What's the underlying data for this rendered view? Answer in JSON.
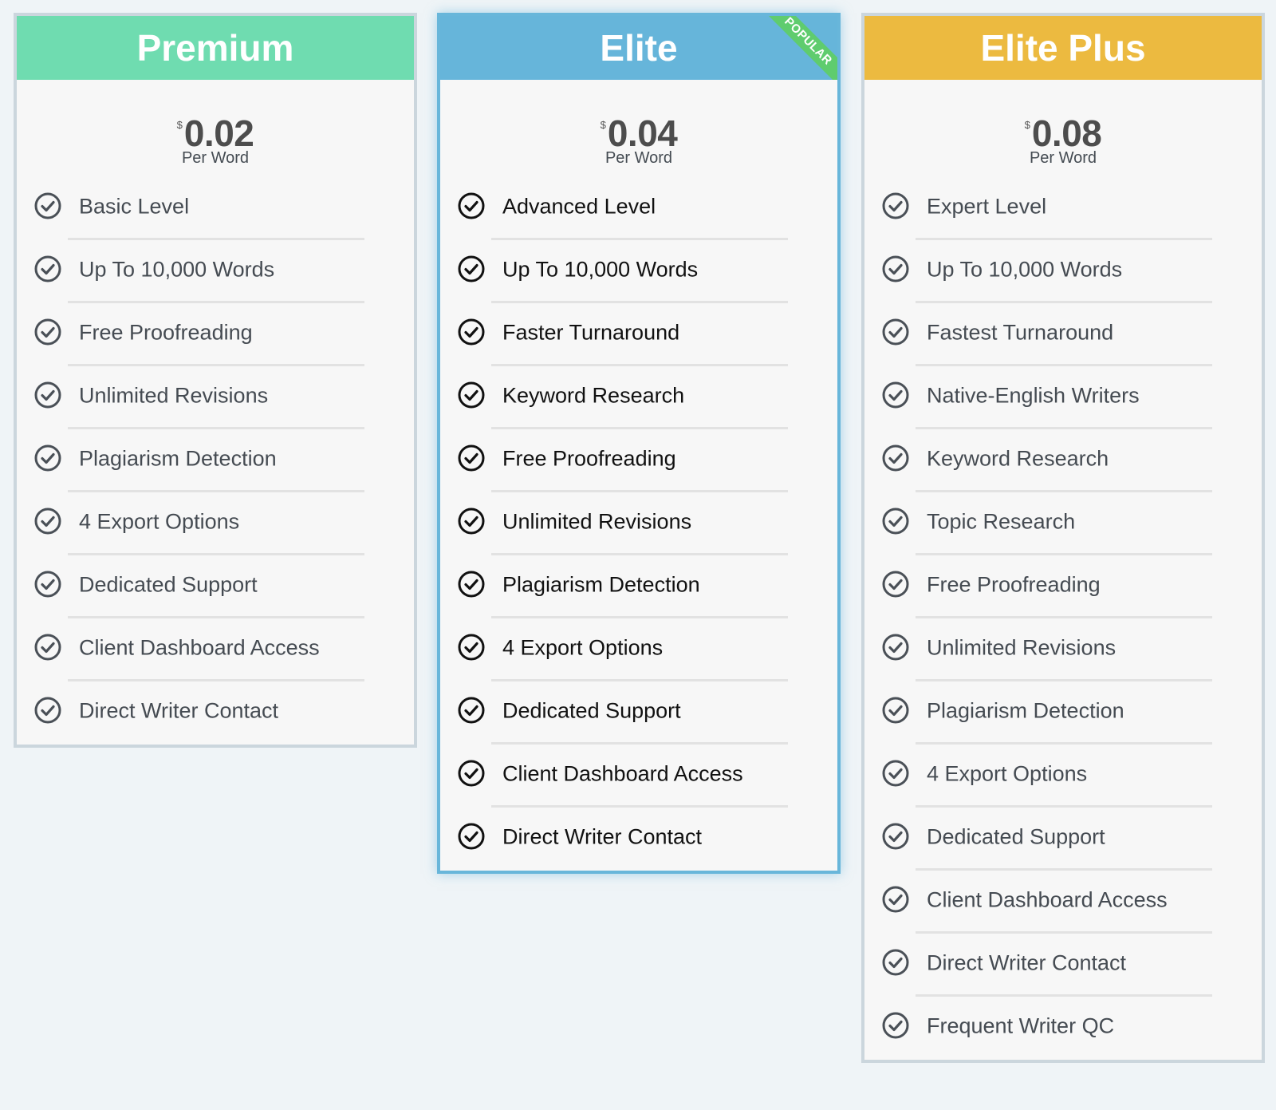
{
  "colors": {
    "premium": "#6fdcb0",
    "elite": "#66b5da",
    "elite_plus": "#ecba40",
    "ribbon": "#5fcc6e",
    "background": "#eff4f7"
  },
  "plans": [
    {
      "name": "Premium",
      "currency": "$",
      "price": "0.02",
      "unit": "Per Word",
      "features": [
        "Basic Level",
        "Up To 10,000 Words",
        "Free Proofreading",
        "Unlimited Revisions",
        "Plagiarism Detection",
        "4 Export Options",
        "Dedicated Support",
        "Client Dashboard Access",
        "Direct Writer Contact"
      ]
    },
    {
      "name": "Elite",
      "badge": "POPULAR",
      "currency": "$",
      "price": "0.04",
      "unit": "Per Word",
      "features": [
        "Advanced Level",
        "Up To 10,000 Words",
        "Faster Turnaround",
        "Keyword Research",
        "Free Proofreading",
        "Unlimited Revisions",
        "Plagiarism Detection",
        "4 Export Options",
        "Dedicated Support",
        "Client Dashboard Access",
        "Direct Writer Contact"
      ]
    },
    {
      "name": "Elite Plus",
      "currency": "$",
      "price": "0.08",
      "unit": "Per Word",
      "features": [
        "Expert Level",
        "Up To 10,000 Words",
        "Fastest Turnaround",
        "Native-English Writers",
        "Keyword Research",
        "Topic Research",
        "Free Proofreading",
        "Unlimited Revisions",
        "Plagiarism Detection",
        "4 Export Options",
        "Dedicated Support",
        "Client Dashboard Access",
        "Direct Writer Contact",
        "Frequent Writer QC"
      ]
    }
  ]
}
